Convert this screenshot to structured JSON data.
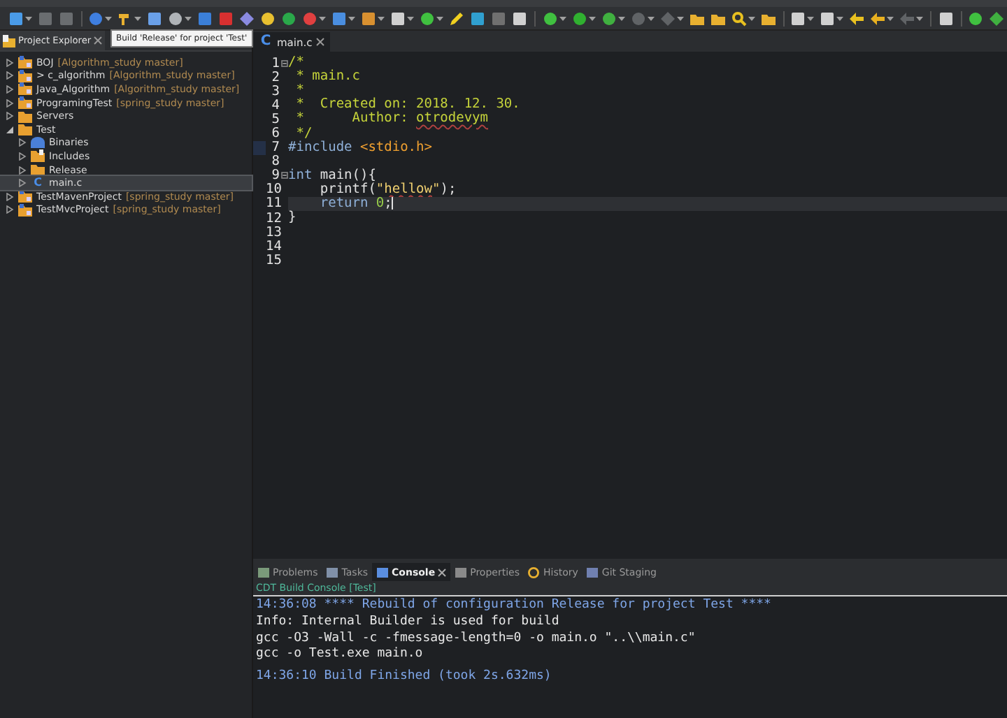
{
  "tooltip": "Build 'Release' for project 'Test'",
  "explorer": {
    "title": "Project Explorer",
    "tree": [
      {
        "kind": "project",
        "label": "BOJ",
        "repo": "[Algorithm_study master]",
        "expanded": false,
        "selected": false
      },
      {
        "kind": "project",
        "label": "> c_algorithm",
        "repo": "[Algorithm_study master]",
        "expanded": false,
        "selected": false
      },
      {
        "kind": "project",
        "label": "Java_Algorithm",
        "repo": "[Algorithm_study master]",
        "expanded": false,
        "selected": false
      },
      {
        "kind": "project",
        "label": "ProgramingTest",
        "repo": "[spring_study master]",
        "expanded": false,
        "selected": false
      },
      {
        "kind": "folder",
        "label": "Servers",
        "expanded": false,
        "selected": false
      },
      {
        "kind": "folder",
        "label": "Test",
        "expanded": true,
        "selected": false,
        "children": [
          {
            "kind": "binaries",
            "label": "Binaries",
            "expanded": false,
            "selected": false
          },
          {
            "kind": "includes",
            "label": "Includes",
            "expanded": false,
            "selected": false
          },
          {
            "kind": "folder",
            "label": "Release",
            "expanded": false,
            "selected": false
          },
          {
            "kind": "file",
            "icon_text": "C",
            "label": "main.c",
            "expanded": false,
            "selected": true
          }
        ]
      },
      {
        "kind": "project",
        "label": "TestMavenProject",
        "repo": "[spring_study master]",
        "expanded": false,
        "selected": false
      },
      {
        "kind": "project",
        "label": "TestMvcProject",
        "repo": "[spring_study master]",
        "expanded": false,
        "selected": false
      }
    ]
  },
  "editor": {
    "tab": {
      "icon_text": "C",
      "label": "main.c"
    },
    "lines": [
      {
        "num": "1",
        "fold": true,
        "current": false,
        "marker": false,
        "tokens": [
          {
            "kind": "comment",
            "text": "/*"
          }
        ]
      },
      {
        "num": "2",
        "fold": false,
        "current": false,
        "marker": false,
        "tokens": [
          {
            "kind": "comment",
            "text": " * main.c"
          }
        ]
      },
      {
        "num": "3",
        "fold": false,
        "current": false,
        "marker": false,
        "tokens": [
          {
            "kind": "comment",
            "text": " *"
          }
        ]
      },
      {
        "num": "4",
        "fold": false,
        "current": false,
        "marker": false,
        "tokens": [
          {
            "kind": "comment",
            "text": " *  Created on: 2018. 12. 30."
          }
        ]
      },
      {
        "num": "5",
        "fold": false,
        "current": false,
        "marker": false,
        "tokens": [
          {
            "kind": "comment",
            "text": " *      Author: "
          },
          {
            "kind": "misspelled-comment",
            "text": "otrodevym"
          }
        ]
      },
      {
        "num": "6",
        "fold": false,
        "current": false,
        "marker": false,
        "tokens": [
          {
            "kind": "comment",
            "text": " */"
          }
        ]
      },
      {
        "num": "7",
        "fold": false,
        "current": false,
        "marker": true,
        "tokens": [
          {
            "kind": "keyword",
            "text": "#include"
          },
          {
            "kind": "include-path",
            "text": " <stdio.h>"
          }
        ]
      },
      {
        "num": "8",
        "fold": false,
        "current": false,
        "marker": false
      },
      {
        "num": "9",
        "fold": true,
        "current": false,
        "marker": false,
        "tokens": [
          {
            "kind": "keyword",
            "text": "int"
          },
          {
            "kind": "text",
            "text": " main(){"
          }
        ]
      },
      {
        "num": "10",
        "fold": false,
        "current": false,
        "marker": false,
        "tokens": [
          {
            "kind": "text",
            "text": "    printf("
          },
          {
            "kind": "string",
            "text": "\""
          },
          {
            "kind": "misspelled-string",
            "text": "hellow"
          },
          {
            "kind": "string",
            "text": "\""
          },
          {
            "kind": "text",
            "text": ");"
          }
        ]
      },
      {
        "num": "11",
        "fold": false,
        "current": true,
        "marker": false,
        "tokens": [
          {
            "kind": "keyword",
            "text": "    return"
          },
          {
            "kind": "number",
            "text": " 0"
          },
          {
            "kind": "text",
            "text": ";"
          }
        ]
      },
      {
        "num": "12",
        "fold": false,
        "current": false,
        "marker": false,
        "tokens": [
          {
            "kind": "text",
            "text": "}"
          }
        ]
      },
      {
        "num": "13",
        "fold": false,
        "current": false,
        "marker": false
      },
      {
        "num": "14",
        "fold": false,
        "current": false,
        "marker": false
      },
      {
        "num": "15",
        "fold": false,
        "current": false,
        "marker": false
      }
    ]
  },
  "bottom": {
    "tabs": [
      {
        "kind": "problems",
        "label": "Problems",
        "selected": false
      },
      {
        "kind": "tasks",
        "label": "Tasks",
        "selected": false
      },
      {
        "kind": "console",
        "label": "Console",
        "selected": true
      },
      {
        "kind": "properties",
        "label": "Properties",
        "selected": false
      },
      {
        "kind": "history",
        "label": "History",
        "selected": false
      },
      {
        "kind": "git",
        "label": "Git Staging",
        "selected": false
      }
    ],
    "console_title": "CDT Build Console [Test]",
    "console_blocks": [
      [
        {
          "kind": "info",
          "text": "14:36:08 **** Rebuild of configuration Release for project Test ****"
        },
        {
          "kind": "output",
          "text": "Info: Internal Builder is used for build"
        },
        {
          "kind": "output",
          "text": "gcc -O3 -Wall -c -fmessage-length=0 -o main.o \"..\\\\main.c\""
        },
        {
          "kind": "output",
          "text": "gcc -o Test.exe main.o"
        }
      ],
      [
        {
          "kind": "info",
          "text": "14:36:10 Build Finished (took 2s.632ms)"
        }
      ]
    ]
  }
}
